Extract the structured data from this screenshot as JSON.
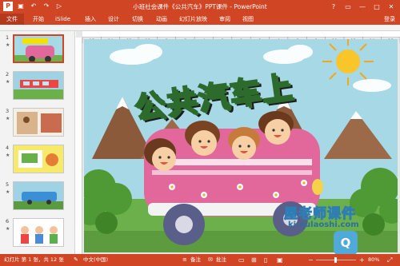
{
  "window": {
    "title": "小班社会课件《公共汽车》PPT课件 - PowerPoint",
    "controls": [
      "?",
      "▭",
      "—",
      "□",
      "✕"
    ]
  },
  "quick_access": [
    "save-icon",
    "undo-icon",
    "redo-icon",
    "slideshow-icon"
  ],
  "ribbon": {
    "file_tab": "文件",
    "tabs": [
      "开始",
      "iSlide",
      "插入",
      "设计",
      "切换",
      "动画",
      "幻灯片放映",
      "审阅",
      "视图"
    ],
    "login": "登录"
  },
  "slides": [
    {
      "number": "1",
      "star": "★"
    },
    {
      "number": "2",
      "star": "★"
    },
    {
      "number": "3",
      "star": "★"
    },
    {
      "number": "4",
      "star": "★"
    },
    {
      "number": "5",
      "star": "★"
    },
    {
      "number": "6",
      "star": "★"
    }
  ],
  "ruler": {
    "h_labels": [
      "16",
      "14",
      "12",
      "10",
      "8",
      "6",
      "4",
      "2",
      "0",
      "2",
      "4",
      "6",
      "8",
      "10",
      "12",
      "14",
      "16"
    ]
  },
  "slide": {
    "title": "公共汽车上"
  },
  "watermark": {
    "name": "屋老师课件",
    "site": "kj.qulaoshi.com"
  },
  "status": {
    "slide_info": "幻灯片 第 1 张，共 12 张",
    "language": "中文(中国)",
    "notes": "备注",
    "comments": "批注",
    "zoom": "80%"
  },
  "colors": {
    "accent": "#d04524",
    "sky": "#a6d8e6",
    "bus": "#e2679a",
    "title_yellow": "#f5e000",
    "title_green": "#3c8c3c"
  }
}
